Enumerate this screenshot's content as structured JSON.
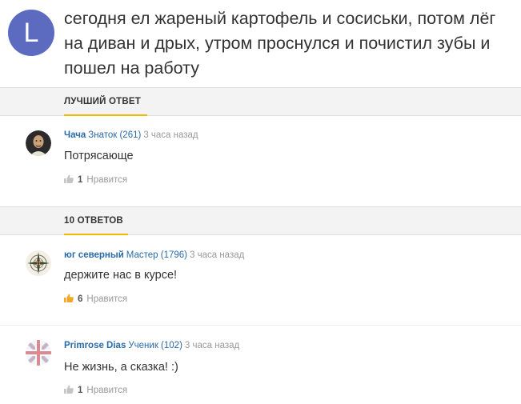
{
  "question": {
    "avatar_letter": "L",
    "text": "сегодня ел жареный картофель и сосиськи, потом лёг на диван и дрых, утром проснулся и почистил зубы и пошел на работу"
  },
  "best_answer_section": {
    "title": "ЛУЧШИЙ ОТВЕТ"
  },
  "best_answer": {
    "author": "Чача",
    "rank": "Знаток (261)",
    "time": "3 часа назад",
    "text": "Потрясающе",
    "likes": "1",
    "like_label": "Нравится",
    "avatar_icon": "portrait-avatar"
  },
  "answers_section": {
    "title": "10 ОТВЕТОВ"
  },
  "answers": [
    {
      "author": "юг северный",
      "rank": "Мастер (1796)",
      "time": "3 часа назад",
      "text": "держите нас в курсе!",
      "likes": "6",
      "like_label": "Нравится",
      "avatar_icon": "compass-rose-avatar",
      "liked_color": "#f5a623"
    },
    {
      "author": "Primrose Dias",
      "rank": "Ученик (102)",
      "time": "3 часа назад",
      "text": "Не жизнь, а сказка! :)",
      "likes": "1",
      "like_label": "Нравится",
      "avatar_icon": "union-jack-avatar"
    }
  ],
  "colors": {
    "accent": "#f5b800",
    "author_link": "#2a6aa8",
    "question_avatar": "#5c6bc0"
  }
}
